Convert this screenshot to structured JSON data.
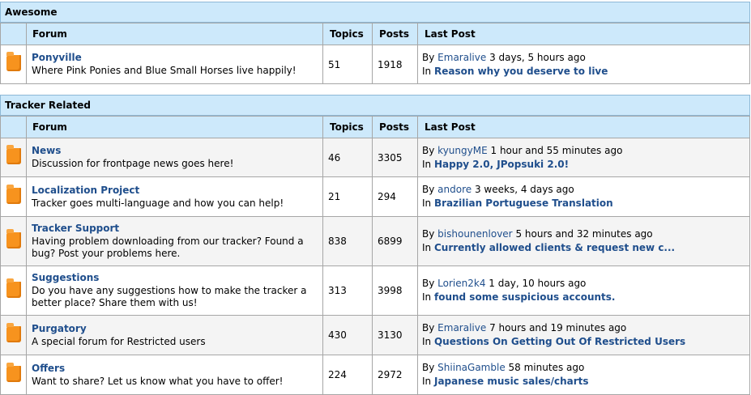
{
  "sections": [
    {
      "title": "Awesome",
      "columns": {
        "forum": "Forum",
        "topics": "Topics",
        "posts": "Posts",
        "last_post": "Last Post"
      },
      "forums": [
        {
          "name": "Ponyville",
          "desc": "Where Pink Ponies and Blue Small Horses live happily!",
          "topics": "51",
          "posts": "1918",
          "by": "By",
          "user": "Emaralive",
          "time": "3 days, 5 hours ago",
          "in": "In",
          "topic": "Reason why you deserve to live"
        }
      ]
    },
    {
      "title": "Tracker Related",
      "columns": {
        "forum": "Forum",
        "topics": "Topics",
        "posts": "Posts",
        "last_post": "Last Post"
      },
      "forums": [
        {
          "name": "News",
          "desc": "Discussion for frontpage news goes here!",
          "topics": "46",
          "posts": "3305",
          "by": "By",
          "user": "kyungyME",
          "time": "1 hour and 55 minutes ago",
          "in": "In",
          "topic": "Happy 2.0, JPopsuki 2.0!"
        },
        {
          "name": "Localization Project",
          "desc": "Tracker goes multi-language and how you can help!",
          "topics": "21",
          "posts": "294",
          "by": "By",
          "user": "andore",
          "time": "3 weeks, 4 days ago",
          "in": "In",
          "topic": "Brazilian Portuguese Translation"
        },
        {
          "name": "Tracker Support",
          "desc": "Having problem downloading from our tracker? Found a bug? Post your problems here.",
          "topics": "838",
          "posts": "6899",
          "by": "By",
          "user": "bishounenlover",
          "time": "5 hours and 32 minutes ago",
          "in": "In",
          "topic": "Currently allowed clients & request new c..."
        },
        {
          "name": "Suggestions",
          "desc": "Do you have any suggestions how to make the tracker a better place? Share them with us!",
          "topics": "313",
          "posts": "3998",
          "by": "By",
          "user": "Lorien2k4",
          "time": "1 day, 10 hours ago",
          "in": "In",
          "topic": "found some suspicious accounts."
        },
        {
          "name": "Purgatory",
          "desc": "A special forum for Restricted users",
          "topics": "430",
          "posts": "3130",
          "by": "By",
          "user": "Emaralive",
          "time": "7 hours and 19 minutes ago",
          "in": "In",
          "topic": "Questions On Getting Out Of Restricted Users"
        },
        {
          "name": "Offers",
          "desc": "Want to share? Let us know what you have to offer!",
          "topics": "224",
          "posts": "2972",
          "by": "By",
          "user": "ShiinaGamble",
          "time": "58 minutes ago",
          "in": "In",
          "topic": "Japanese music sales/charts"
        }
      ]
    }
  ]
}
